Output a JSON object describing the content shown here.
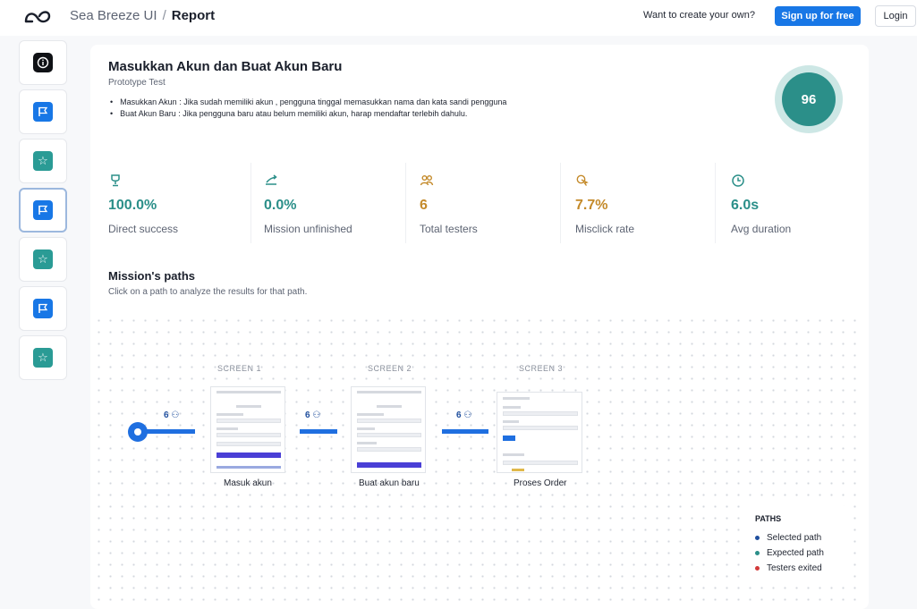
{
  "header": {
    "app_name": "Sea Breeze UI",
    "separator": "/",
    "page_name": "Report",
    "promo_text": "Want to create your own?",
    "signup_label": "Sign up for free",
    "login_label": "Login",
    "logo_icon": "infinity-cloud-logo"
  },
  "sidebar": {
    "items": [
      {
        "icon": "info-icon",
        "active": false
      },
      {
        "icon": "flag-icon",
        "active": false
      },
      {
        "icon": "star-icon",
        "active": false
      },
      {
        "icon": "flag-icon",
        "active": true
      },
      {
        "icon": "star-icon",
        "active": false
      },
      {
        "icon": "flag-icon",
        "active": false
      },
      {
        "icon": "star-icon",
        "active": false
      }
    ]
  },
  "mission": {
    "title": "Masukkan Akun dan Buat Akun Baru",
    "subtitle": "Prototype Test",
    "bullets": [
      "Masukkan Akun : Jika sudah memiliki akun , pengguna tinggal memasukkan nama dan kata sandi pengguna",
      "Buat Akun Baru : Jika pengguna baru atau belum memiliki akun, harap mendaftar terlebih dahulu."
    ],
    "score": "96"
  },
  "metrics": [
    {
      "value": "100.0%",
      "label": "Direct success",
      "icon": "trophy-icon",
      "color": "#2b8f89"
    },
    {
      "value": "0.0%",
      "label": "Mission unfinished",
      "icon": "fork-arrow-icon",
      "color": "#2b8f89"
    },
    {
      "value": "6",
      "label": "Total testers",
      "icon": "users-icon",
      "color": "#c48a2a"
    },
    {
      "value": "7.7%",
      "label": "Misclick rate",
      "icon": "cursor-click-icon",
      "color": "#c48a2a"
    },
    {
      "value": "6.0s",
      "label": "Avg duration",
      "icon": "clock-icon",
      "color": "#2b8f89"
    }
  ],
  "paths": {
    "title": "Mission's paths",
    "subtitle": "Click on a path to analyze the results for that path.",
    "screens": [
      {
        "label": "SCREEN 1",
        "name": "Masuk akun",
        "count": "6"
      },
      {
        "label": "SCREEN 2",
        "name": "Buat akun baru",
        "count": "6"
      },
      {
        "label": "SCREEN 3",
        "name": "Proses Order",
        "count": "6"
      }
    ],
    "legend": {
      "title": "PATHS",
      "items": [
        {
          "label": "Selected path",
          "color": "#1f4f9e"
        },
        {
          "label": "Expected path",
          "color": "#2b8f89"
        },
        {
          "label": "Testers exited",
          "color": "#d23a3a"
        }
      ]
    }
  }
}
